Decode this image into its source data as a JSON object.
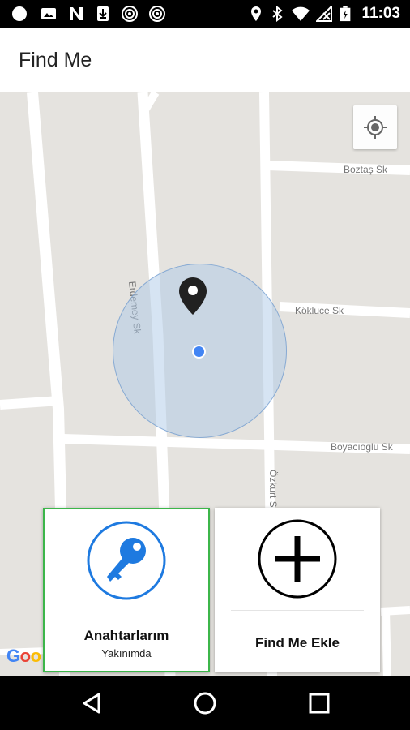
{
  "status_bar": {
    "time": "11:03",
    "left_icons": [
      "notification-dot-icon",
      "image-icon",
      "n-logo-icon",
      "download-icon",
      "podcast-icon",
      "podcast-icon"
    ],
    "right_icons": [
      "location-icon",
      "bluetooth-icon",
      "wifi-icon",
      "no-signal-icon",
      "battery-charging-icon"
    ]
  },
  "app_bar": {
    "title": "Find Me"
  },
  "map": {
    "streets": {
      "boztas": "Boztaş Sk",
      "erdemey": "Erdemey Sk",
      "kokluce": "Kökluce Sk",
      "boyacioglu": "Boyacıoglu Sk",
      "ozkurt": "Özkurt S"
    },
    "logo": [
      "G",
      "o",
      "o"
    ],
    "colors": {
      "accuracy_fill": "#adc9e8",
      "location_dot": "#4285f4"
    }
  },
  "cards": {
    "keys": {
      "title": "Anahtarlarım",
      "subtitle": "Yakınımda",
      "icon": "key-icon",
      "border_color": "#3cb64a",
      "icon_color": "#1e7ae0"
    },
    "add": {
      "title": "Find Me Ekle",
      "icon": "add-circle-icon"
    }
  },
  "nav_bar": {
    "buttons": [
      "back-icon",
      "home-icon",
      "recents-icon"
    ]
  }
}
